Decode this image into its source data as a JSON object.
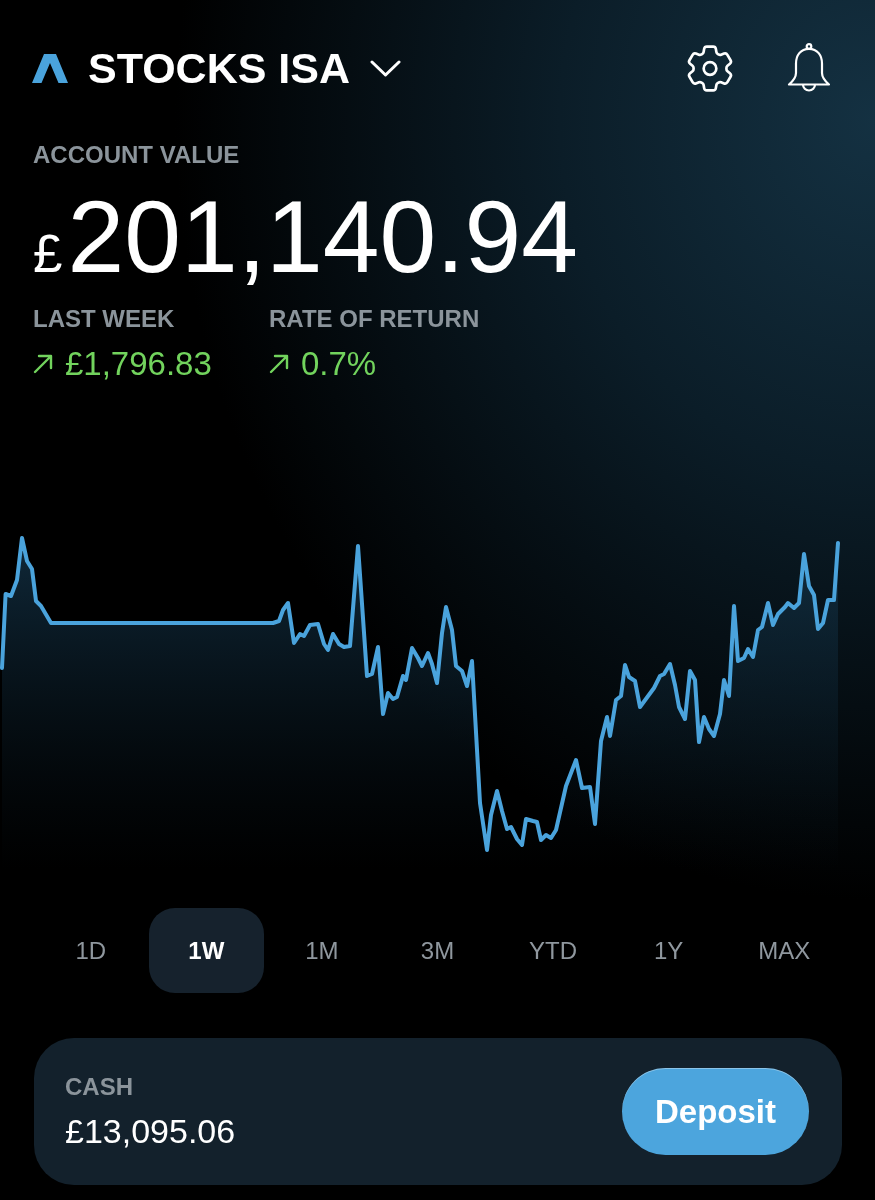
{
  "header": {
    "account_name": "STOCKS ISA"
  },
  "account_value": {
    "label": "ACCOUNT VALUE",
    "currency": "£",
    "amount": "201,140.94"
  },
  "stats": [
    {
      "label": "LAST WEEK",
      "value": "£1,796.83",
      "rising": true
    },
    {
      "label": "RATE OF RETURN",
      "value": "0.7%",
      "rising": true
    }
  ],
  "range_tabs": [
    {
      "label": "1D",
      "selected": false
    },
    {
      "label": "1W",
      "selected": true
    },
    {
      "label": "1M",
      "selected": false
    },
    {
      "label": "3M",
      "selected": false
    },
    {
      "label": "YTD",
      "selected": false
    },
    {
      "label": "1Y",
      "selected": false
    },
    {
      "label": "MAX",
      "selected": false
    }
  ],
  "cash": {
    "label": "CASH",
    "amount": "£13,095.06",
    "button": "Deposit"
  }
}
